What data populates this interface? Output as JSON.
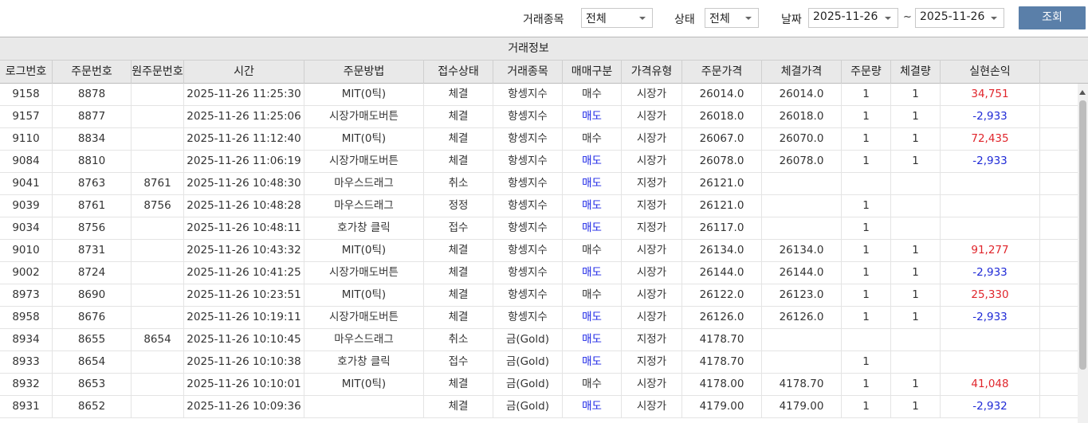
{
  "filters": {
    "symbol_label": "거래종목",
    "symbol_value": "전체",
    "status_label": "상태",
    "status_value": "전체",
    "date_label": "날짜",
    "date_from": "2025-11-26",
    "date_sep": "~",
    "date_to": "2025-11-26",
    "search_label": "조회"
  },
  "grid": {
    "group_title": "거래정보",
    "columns": [
      "로그번호",
      "주문번호",
      "원주문번호",
      "시간",
      "주문방법",
      "접수상태",
      "거래종목",
      "매매구분",
      "가격유형",
      "주문가격",
      "체결가격",
      "주문량",
      "체결량",
      "실현손익",
      ""
    ],
    "rows": [
      [
        "9158",
        "8878",
        "",
        "2025-11-26 11:25:30",
        "MIT(0틱)",
        "체결",
        "항셍지수",
        "매수",
        "시장가",
        "26014.0",
        "26014.0",
        "1",
        "1",
        "34,751",
        ""
      ],
      [
        "9157",
        "8877",
        "",
        "2025-11-26 11:25:06",
        "시장가매도버튼",
        "체결",
        "항셍지수",
        "매도",
        "시장가",
        "26018.0",
        "26018.0",
        "1",
        "1",
        "-2,933",
        ""
      ],
      [
        "9110",
        "8834",
        "",
        "2025-11-26 11:12:40",
        "MIT(0틱)",
        "체결",
        "항셍지수",
        "매수",
        "시장가",
        "26067.0",
        "26070.0",
        "1",
        "1",
        "72,435",
        ""
      ],
      [
        "9084",
        "8810",
        "",
        "2025-11-26 11:06:19",
        "시장가매도버튼",
        "체결",
        "항셍지수",
        "매도",
        "시장가",
        "26078.0",
        "26078.0",
        "1",
        "1",
        "-2,933",
        ""
      ],
      [
        "9041",
        "8763",
        "8761",
        "2025-11-26 10:48:30",
        "마우스드래그",
        "취소",
        "항셍지수",
        "매도",
        "지정가",
        "26121.0",
        "",
        "",
        "",
        "",
        ""
      ],
      [
        "9039",
        "8761",
        "8756",
        "2025-11-26 10:48:28",
        "마우스드래그",
        "정정",
        "항셍지수",
        "매도",
        "지정가",
        "26121.0",
        "",
        "1",
        "",
        "",
        ""
      ],
      [
        "9034",
        "8756",
        "",
        "2025-11-26 10:48:11",
        "호가창 클릭",
        "접수",
        "항셍지수",
        "매도",
        "지정가",
        "26117.0",
        "",
        "1",
        "",
        "",
        ""
      ],
      [
        "9010",
        "8731",
        "",
        "2025-11-26 10:43:32",
        "MIT(0틱)",
        "체결",
        "항셍지수",
        "매수",
        "시장가",
        "26134.0",
        "26134.0",
        "1",
        "1",
        "91,277",
        ""
      ],
      [
        "9002",
        "8724",
        "",
        "2025-11-26 10:41:25",
        "시장가매도버튼",
        "체결",
        "항셍지수",
        "매도",
        "시장가",
        "26144.0",
        "26144.0",
        "1",
        "1",
        "-2,933",
        ""
      ],
      [
        "8973",
        "8690",
        "",
        "2025-11-26 10:23:51",
        "MIT(0틱)",
        "체결",
        "항셍지수",
        "매수",
        "시장가",
        "26122.0",
        "26123.0",
        "1",
        "1",
        "25,330",
        ""
      ],
      [
        "8958",
        "8676",
        "",
        "2025-11-26 10:19:11",
        "시장가매도버튼",
        "체결",
        "항셍지수",
        "매도",
        "시장가",
        "26126.0",
        "26126.0",
        "1",
        "1",
        "-2,933",
        ""
      ],
      [
        "8934",
        "8655",
        "8654",
        "2025-11-26 10:10:45",
        "마우스드래그",
        "취소",
        "금(Gold)",
        "매도",
        "지정가",
        "4178.70",
        "",
        "",
        "",
        "",
        ""
      ],
      [
        "8933",
        "8654",
        "",
        "2025-11-26 10:10:38",
        "호가창 클릭",
        "접수",
        "금(Gold)",
        "매도",
        "지정가",
        "4178.70",
        "",
        "1",
        "",
        "",
        ""
      ],
      [
        "8932",
        "8653",
        "",
        "2025-11-26 10:10:01",
        "MIT(0틱)",
        "체결",
        "금(Gold)",
        "매수",
        "시장가",
        "4178.00",
        "4178.70",
        "1",
        "1",
        "41,048",
        ""
      ],
      [
        "8931",
        "8652",
        "",
        "2025-11-26 10:09:36",
        "",
        "체결",
        "금(Gold)",
        "매도",
        "시장가",
        "4179.00",
        "4179.00",
        "1",
        "1",
        "-2,932",
        ""
      ]
    ]
  },
  "colors": {
    "profit": "#e0262c",
    "loss": "#1f2ad6",
    "sell": "#1c26e6",
    "search_button": "#5a7fa9"
  }
}
